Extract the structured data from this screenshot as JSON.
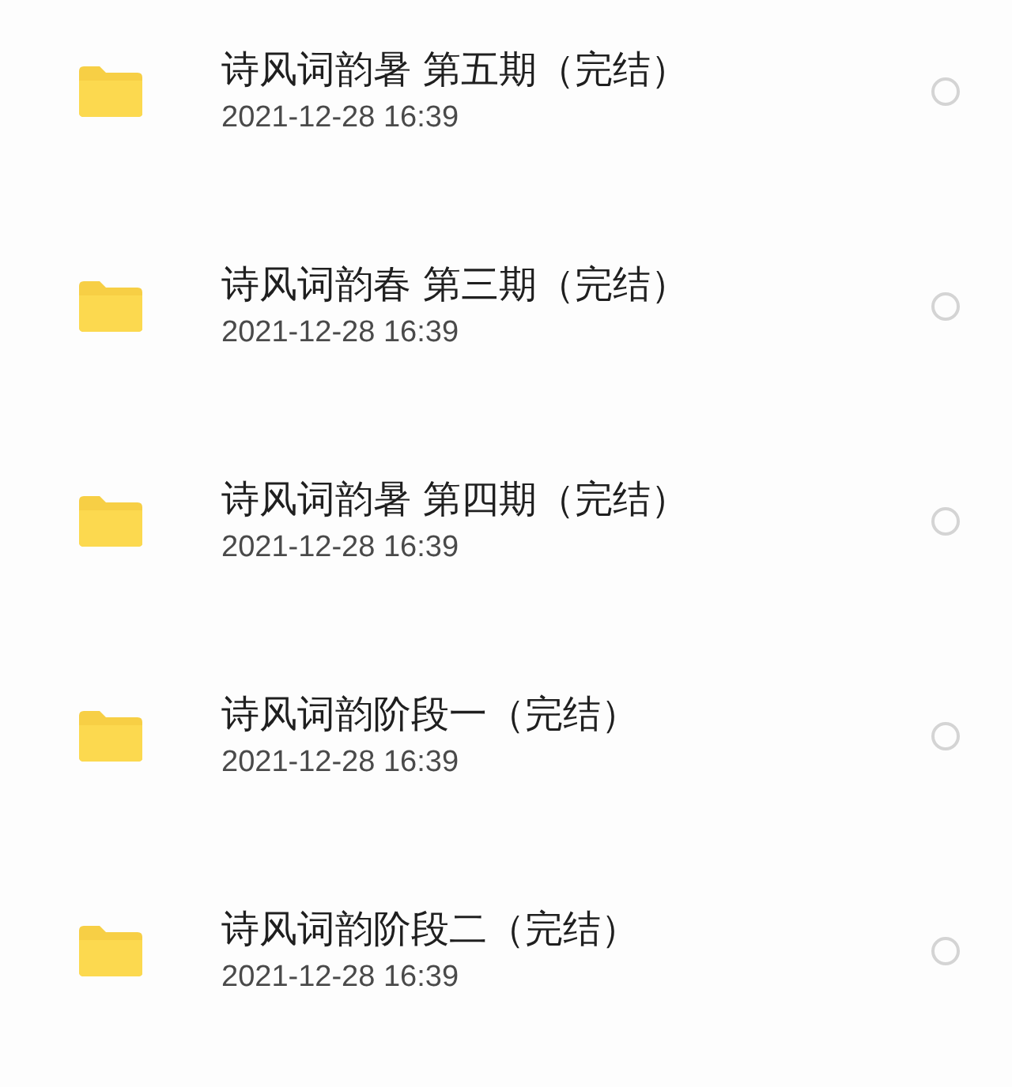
{
  "files": [
    {
      "name": "诗风词韵暑 第五期（完结）",
      "date": "2021-12-28 16:39",
      "selected": false
    },
    {
      "name": "诗风词韵春 第三期（完结）",
      "date": "2021-12-28 16:39",
      "selected": false
    },
    {
      "name": "诗风词韵暑 第四期（完结）",
      "date": "2021-12-28 16:39",
      "selected": false
    },
    {
      "name": "诗风词韵阶段一（完结）",
      "date": "2021-12-28 16:39",
      "selected": false
    },
    {
      "name": "诗风词韵阶段二（完结）",
      "date": "2021-12-28 16:39",
      "selected": false
    }
  ]
}
